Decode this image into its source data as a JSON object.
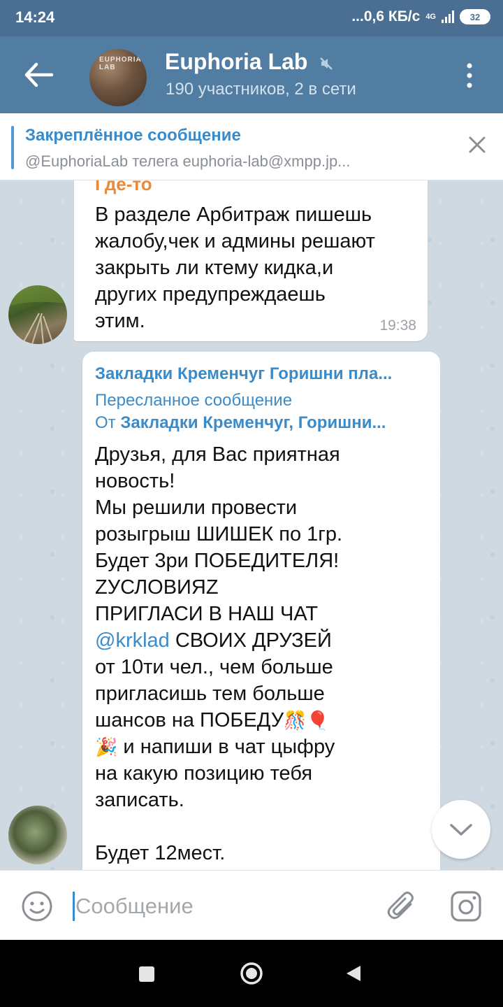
{
  "status_bar": {
    "time": "14:24",
    "network_speed": "...0,6 КБ/с",
    "network_type": "4G",
    "battery": "32"
  },
  "header": {
    "title": "Euphoria Lab",
    "subtitle": "190 участников, 2 в сети",
    "avatar_text": "EUPHORIA LAB"
  },
  "pinned": {
    "title": "Закреплённое сообщение",
    "text": "@EuphoriaLab телега euphoria-lab@xmpp.jp..."
  },
  "messages": [
    {
      "sender_cut": "Где-то",
      "lines": [
        "В разделе Арбитраж пишешь",
        "жалобу,чек и админы решают",
        "закрыть ли ктему кидка,и",
        "других предупреждаешь",
        "этим."
      ],
      "time": "19:38"
    },
    {
      "header": "Закладки Кременчуг Горишни пла...",
      "forward_label": "Пересланное сообщение",
      "from_prefix": "От ",
      "from_name": "Закладки Кременчуг, Горишни...",
      "lines": {
        "l1": "Друзья, для Вас приятная",
        "l2": "новость!",
        "l3": "Мы решили провести",
        "l4": "розыгрыш ШИШЕК по 1гр.",
        "l5": "Будет 3ри ПОБЕДИТЕЛЯ!",
        "l6": "ZУСЛОВИЯZ",
        "l7": "ПРИГЛАСИ В НАШ ЧАТ",
        "mention": "@krklad",
        "l8_rest": " СВОИХ ДРУЗЕЙ",
        "l9": "от 10ти чел., чем больше",
        "l10": "пригласишь тем больше",
        "l11": "шансов на ПОБЕДУ",
        "l11_emoji": "🎊🎈",
        "l12_emoji": "🎉",
        "l12": " и напиши в чат цыфру",
        "l13": "на какую позицию тебя",
        "l14": "записать.",
        "l15": "Будет 12мест."
      }
    }
  ],
  "input": {
    "placeholder": "Сообщение"
  },
  "colors": {
    "header": "#517da2",
    "status_bar": "#4a6f92",
    "accent": "#3a8bc9",
    "sender_orange": "#e88a3c"
  }
}
